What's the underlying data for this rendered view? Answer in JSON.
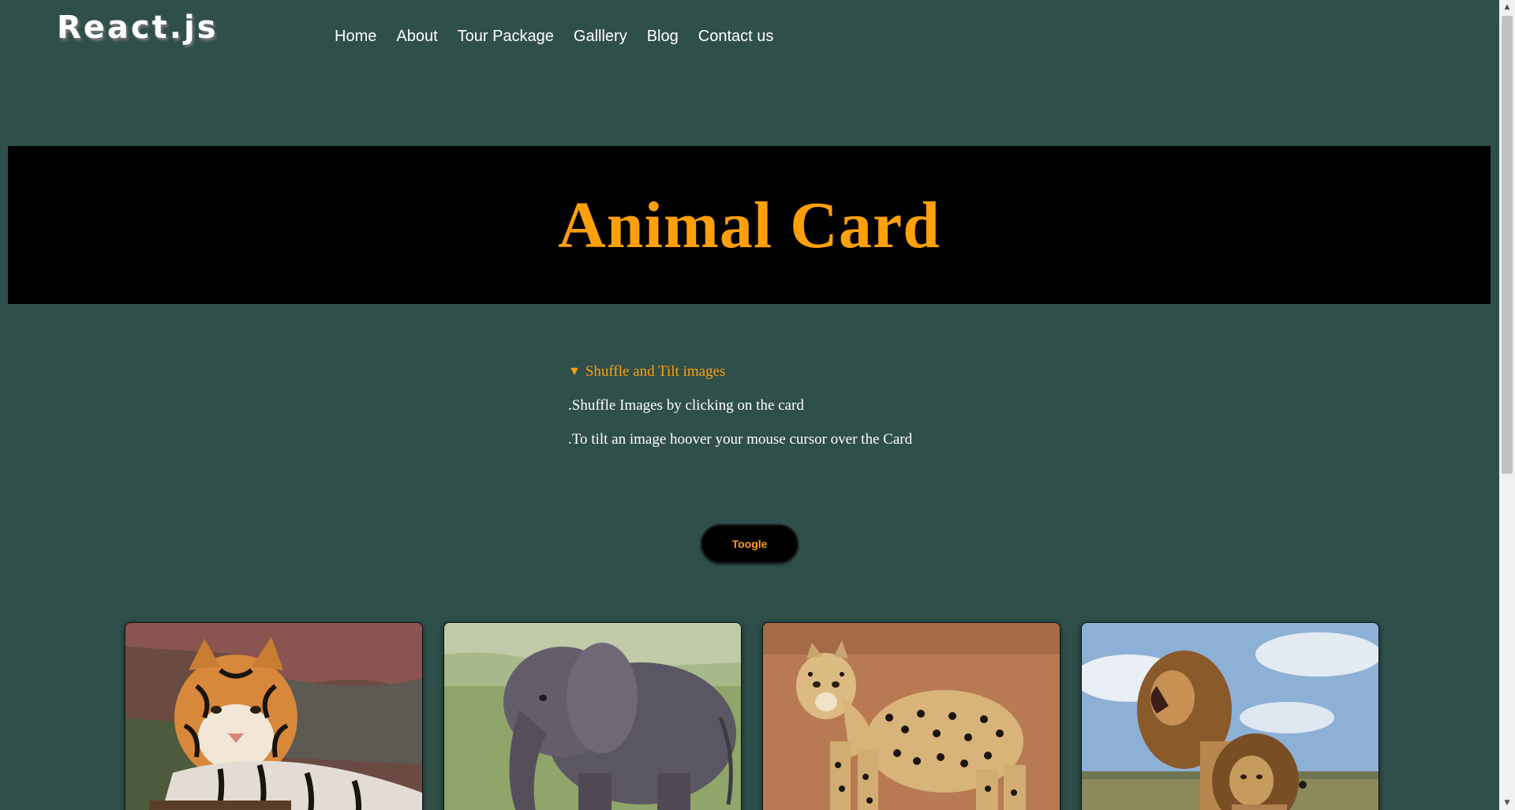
{
  "logo": "React.js",
  "nav": {
    "items": [
      {
        "label": "Home"
      },
      {
        "label": "About"
      },
      {
        "label": "Tour Package"
      },
      {
        "label": "Galllery"
      },
      {
        "label": "Blog"
      },
      {
        "label": "Contact us"
      }
    ]
  },
  "banner": {
    "title": "Animal Card"
  },
  "details": {
    "summary": "Shuffle and Tilt images",
    "line1": ".Shuffle Images by clicking on the card",
    "line2": ".To tilt an image hoover your mouse cursor over the Card"
  },
  "toggle_label": "Toogle",
  "cards": [
    {
      "animal": "tiger"
    },
    {
      "animal": "elephant"
    },
    {
      "animal": "leopard"
    },
    {
      "animal": "lions"
    }
  ],
  "colors": {
    "background": "#2f4f4a",
    "accent": "#ff9f0a",
    "banner": "#000000"
  }
}
